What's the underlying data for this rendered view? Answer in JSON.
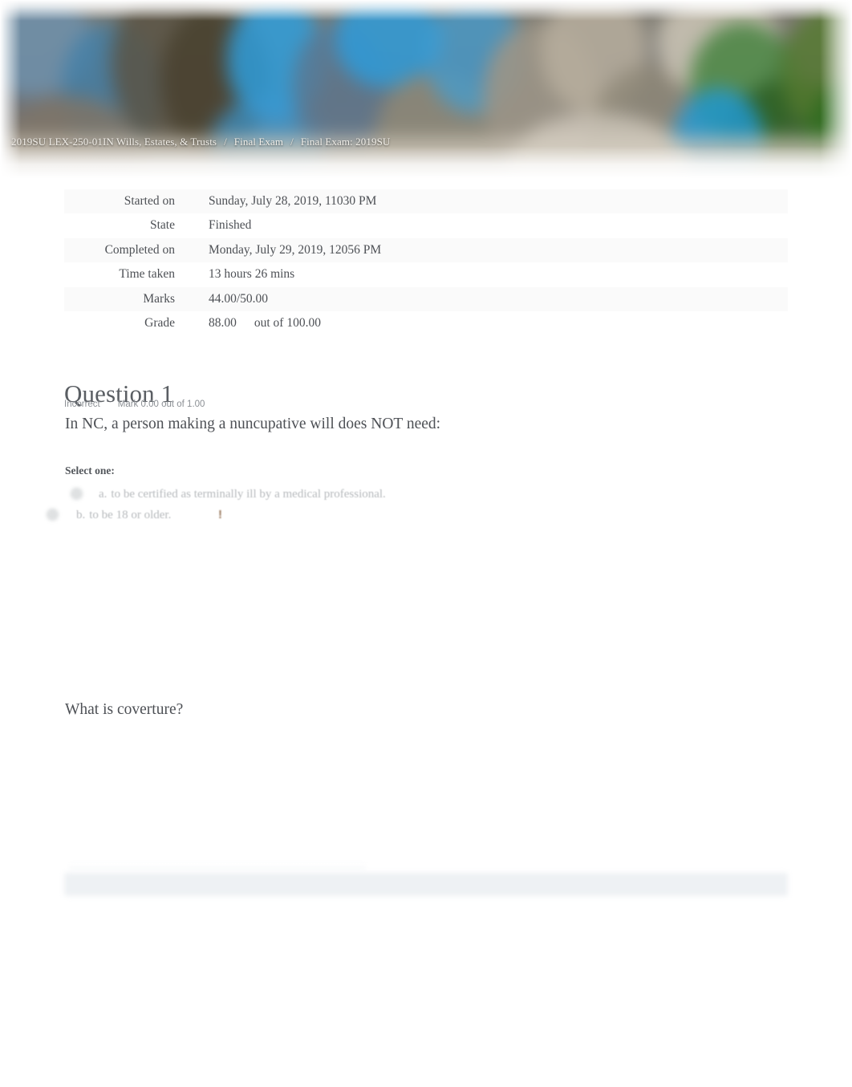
{
  "breadcrumb": {
    "items": [
      {
        "label": "2019SU LEX-250-01IN Wills, Estates, & Trusts"
      },
      {
        "label": "Final Exam"
      },
      {
        "label": "Final Exam:  2019SU"
      }
    ],
    "separator": "/"
  },
  "summary": {
    "rows": [
      {
        "key": "Started on",
        "value": "Sunday, July 28, 2019, 11030 PM"
      },
      {
        "key": "State",
        "value": "Finished"
      },
      {
        "key": "Completed on",
        "value": "Monday, July 29, 2019, 12056 PM"
      },
      {
        "key": "Time taken",
        "value": "13 hours 26 mins"
      },
      {
        "key": "Marks",
        "value": "44.00/50.00"
      },
      {
        "key": "Grade",
        "value": "88.00",
        "suffix": "out of 100.00"
      }
    ]
  },
  "question": {
    "title": "Question 1",
    "state": "Incorrect",
    "mark": "Mark 0.00 out of 1.00",
    "text": "In NC, a person making a nuncupative will does NOT need:",
    "select_one_label": "Select one:",
    "options": [
      {
        "letter": "a.",
        "text": "to be certified as terminally ill by a medical professional.",
        "flag": ""
      },
      {
        "letter": "b.",
        "text": "to be 18 or older.",
        "flag": "!"
      }
    ]
  },
  "question_next": {
    "text": "What is coverture?"
  },
  "colors": {
    "text": "#4d5055",
    "muted": "#8b8f94",
    "option_text": "#b7babd",
    "flag": "#9a7a5f",
    "bar": "#eef1f4",
    "stripe": "#fafafa"
  }
}
